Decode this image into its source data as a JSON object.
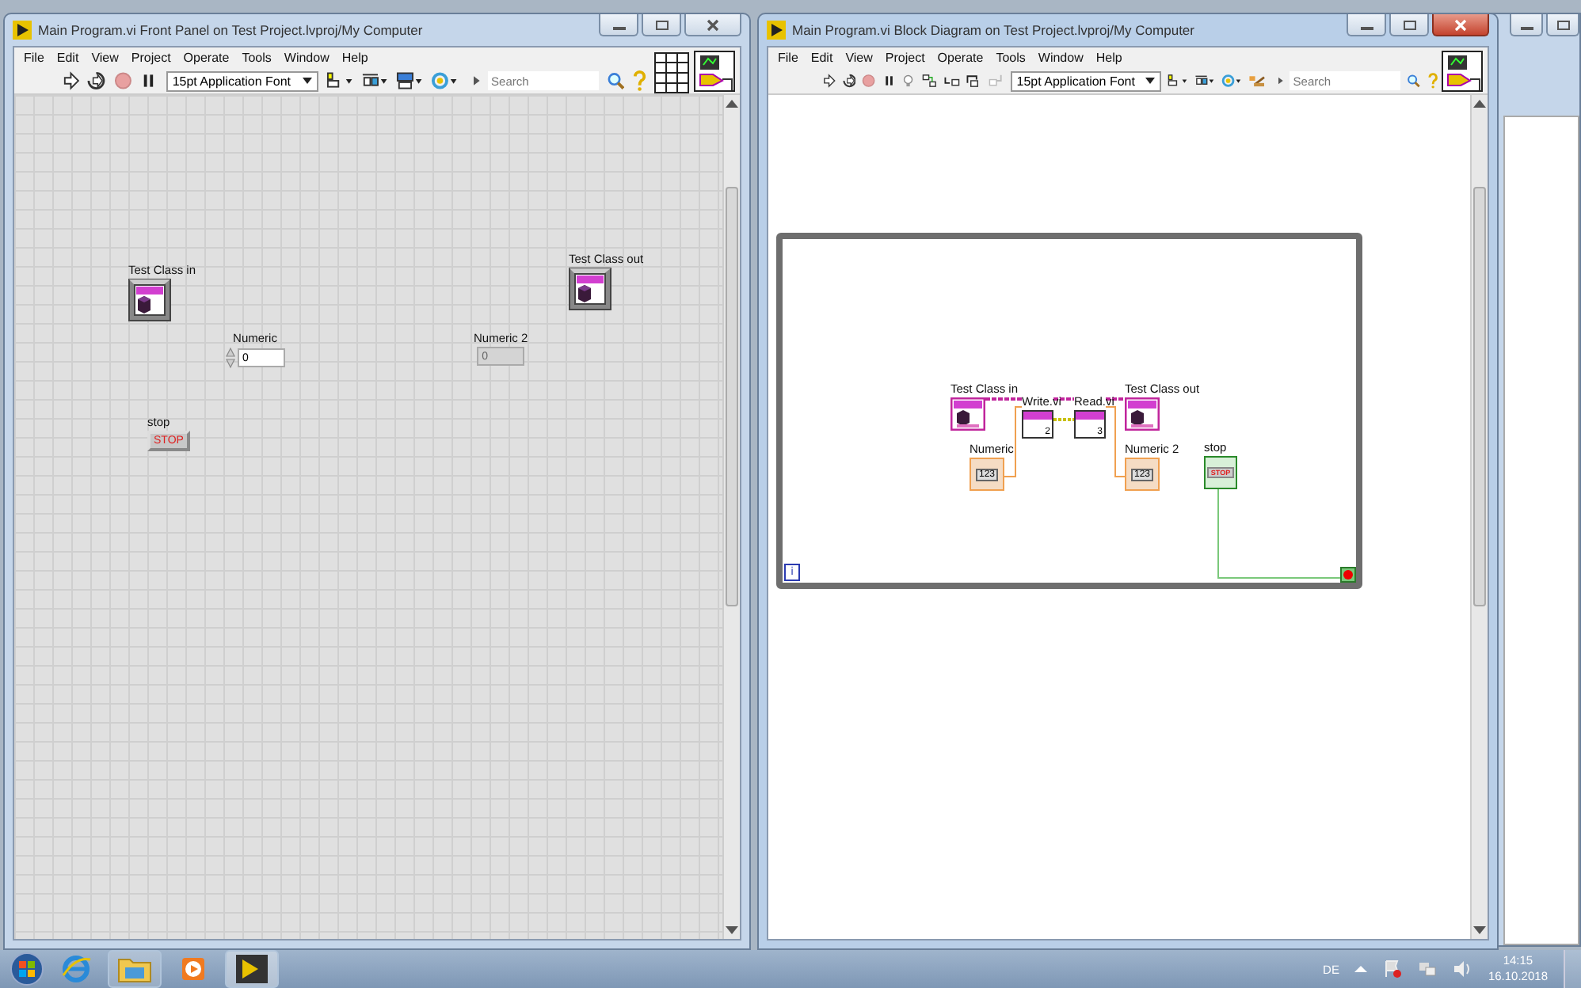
{
  "windows": [
    {
      "kind": "front-panel",
      "title": "Main Program.vi Front Panel on Test Project.lvproj/My Computer",
      "active": false,
      "menu": [
        "File",
        "Edit",
        "View",
        "Project",
        "Operate",
        "Tools",
        "Window",
        "Help"
      ],
      "font_selector": "15pt Application Font",
      "search_placeholder": "Search",
      "objects": [
        {
          "kind": "class",
          "label": "Test Class in"
        },
        {
          "kind": "class",
          "label": "Test Class out"
        },
        {
          "kind": "numeric-control",
          "label": "Numeric",
          "value": "0"
        },
        {
          "kind": "numeric-indicator",
          "label": "Numeric 2",
          "value": "0"
        },
        {
          "kind": "button",
          "label": "stop",
          "text": "STOP"
        }
      ]
    },
    {
      "kind": "block-diagram",
      "title": "Main Program.vi Block Diagram on Test Project.lvproj/My Computer",
      "active": true,
      "menu": [
        "File",
        "Edit",
        "View",
        "Project",
        "Operate",
        "Tools",
        "Window",
        "Help"
      ],
      "font_selector": "15pt Application Font",
      "search_placeholder": "Search",
      "nodes": [
        {
          "kind": "class-terminal",
          "label": "Test Class in"
        },
        {
          "kind": "subvi",
          "label": "Write.vi",
          "text": "2"
        },
        {
          "kind": "subvi",
          "label": "Read.vi",
          "text": "3"
        },
        {
          "kind": "class-terminal",
          "label": "Test Class out"
        },
        {
          "kind": "numeric-terminal",
          "label": "Numeric",
          "text": "123"
        },
        {
          "kind": "numeric-terminal",
          "label": "Numeric 2",
          "text": "123"
        },
        {
          "kind": "boolean-terminal",
          "label": "stop",
          "text": "STOP"
        }
      ],
      "loop_iteration": "i"
    }
  ],
  "taskbar": {
    "language": "DE",
    "time": "14:15",
    "date": "16.10.2018"
  }
}
